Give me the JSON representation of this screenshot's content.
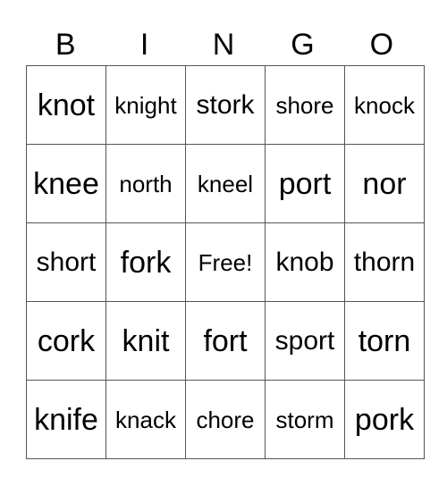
{
  "header": [
    "B",
    "I",
    "N",
    "G",
    "O"
  ],
  "rows": [
    [
      {
        "w": "knot",
        "s": "l"
      },
      {
        "w": "knight",
        "s": "s"
      },
      {
        "w": "stork",
        "s": "m"
      },
      {
        "w": "shore",
        "s": "s"
      },
      {
        "w": "knock",
        "s": "s"
      }
    ],
    [
      {
        "w": "knee",
        "s": "l"
      },
      {
        "w": "north",
        "s": "s"
      },
      {
        "w": "kneel",
        "s": "s"
      },
      {
        "w": "port",
        "s": "l"
      },
      {
        "w": "nor",
        "s": "l"
      }
    ],
    [
      {
        "w": "short",
        "s": "m"
      },
      {
        "w": "fork",
        "s": "l"
      },
      {
        "w": "Free!",
        "s": "s"
      },
      {
        "w": "knob",
        "s": "m"
      },
      {
        "w": "thorn",
        "s": "m"
      }
    ],
    [
      {
        "w": "cork",
        "s": "l"
      },
      {
        "w": "knit",
        "s": "l"
      },
      {
        "w": "fort",
        "s": "l"
      },
      {
        "w": "sport",
        "s": "m"
      },
      {
        "w": "torn",
        "s": "l"
      }
    ],
    [
      {
        "w": "knife",
        "s": "l"
      },
      {
        "w": "knack",
        "s": "s"
      },
      {
        "w": "chore",
        "s": "s"
      },
      {
        "w": "storm",
        "s": "s"
      },
      {
        "w": "pork",
        "s": "l"
      }
    ]
  ]
}
